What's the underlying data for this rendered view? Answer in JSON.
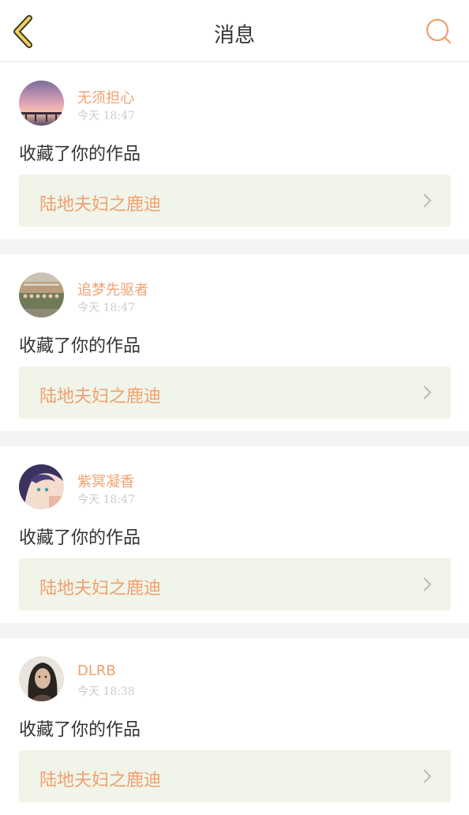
{
  "header": {
    "title": "消息",
    "accent_color": "#f0a070",
    "back_icon": "chevron-left-icon",
    "search_icon": "search-icon"
  },
  "messages": [
    {
      "user": "无须担心",
      "time": "今天 18:47",
      "action": "收藏了你的作品",
      "work": "陆地夫妇之鹿迪",
      "avatar": "sunset-avatar"
    },
    {
      "user": "追梦先驱者",
      "time": "今天 18:47",
      "action": "收藏了你的作品",
      "work": "陆地夫妇之鹿迪",
      "avatar": "group-photo-avatar"
    },
    {
      "user": "紫冥凝香",
      "time": "今天 18:47",
      "action": "收藏了你的作品",
      "work": "陆地夫妇之鹿迪",
      "avatar": "anime-girl-avatar"
    },
    {
      "user": "DLRB",
      "time": "今天 18:38",
      "action": "收藏了你的作品",
      "work": "陆地夫妇之鹿迪",
      "avatar": "woman-portrait-avatar"
    }
  ]
}
